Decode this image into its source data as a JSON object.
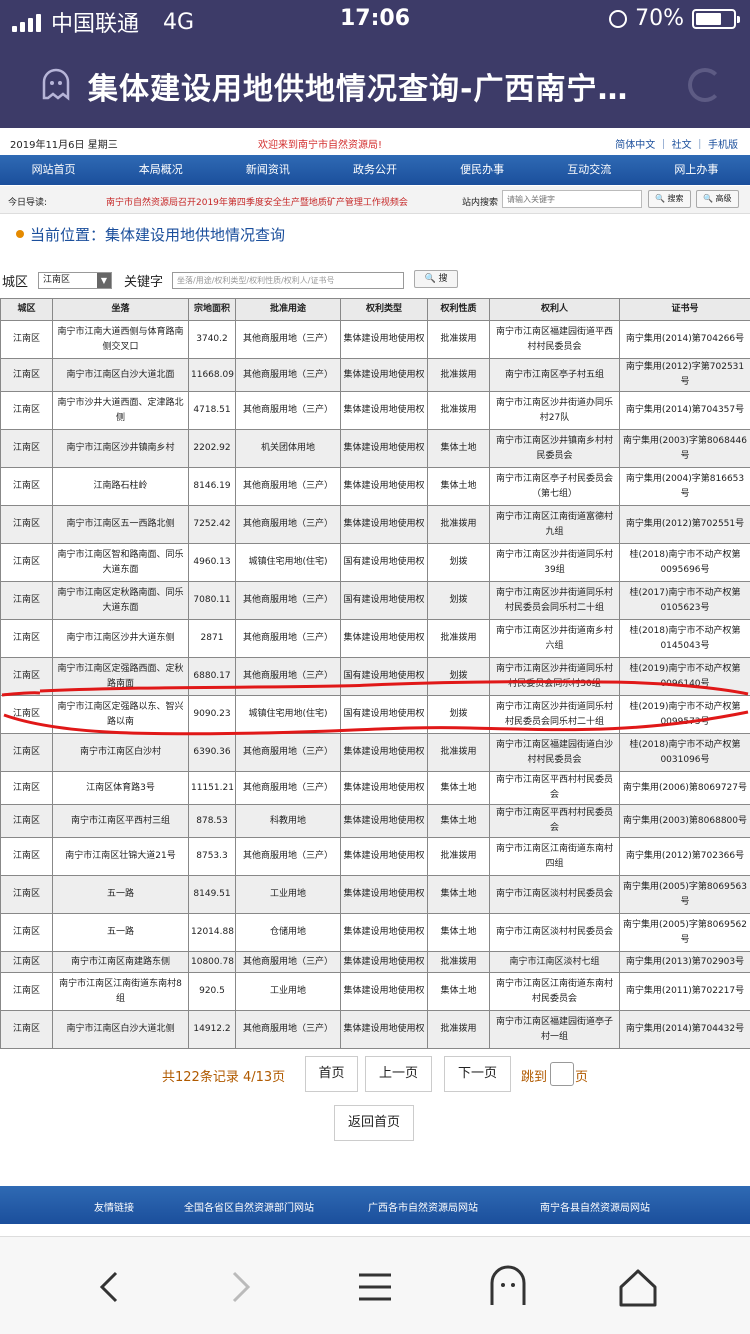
{
  "status": {
    "carrier": "中国联通",
    "network": "4G",
    "time": "17:06",
    "battery": "70%",
    "battery_level": 0.7
  },
  "title": "集体建设用地供地情况查询-广西南宁…",
  "site": {
    "date": "2019年11月6日 星期三",
    "welcome": "欢迎来到南宁市自然资源局!",
    "langs": "简体中文 ｜ 社文 ｜ 手机版",
    "nav": [
      "网站首页",
      "本局概况",
      "新闻资讯",
      "政务公开",
      "便民办事",
      "互动交流",
      "网上办事"
    ],
    "guide_label": "今日导读:",
    "guide_news": "南宁市自然资源局召开2019年第四季度安全生产暨地质矿产管理工作视频会",
    "search_label": "站内搜索",
    "search_placeholder": "请输入关键字",
    "search_btn": "搜索",
    "adv_btn": "高级"
  },
  "crumb": "当前位置：集体建设用地供地情况查询",
  "filter": {
    "district_label": "城区",
    "district_value": "江南区",
    "keyword_label": "关键字",
    "keyword_placeholder": "坐落/用途/权利类型/权利性质/权利人/证书号",
    "search_btn": "搜"
  },
  "table": {
    "headers": [
      "城区",
      "坐落",
      "宗地面积",
      "批准用途",
      "权利类型",
      "权利性质",
      "权利人",
      "证书号"
    ],
    "rows": [
      [
        "江南区",
        "南宁市江南大道西侧与体育路南侧交叉口",
        "3740.2",
        "其他商服用地（三产）",
        "集体建设用地使用权",
        "批准拨用",
        "南宁市江南区福建园街道平西村村民委员会",
        "南宁集用(2014)第704266号"
      ],
      [
        "江南区",
        "南宁市江南区白沙大道北面",
        "11668.09",
        "其他商服用地（三产）",
        "集体建设用地使用权",
        "批准拨用",
        "南宁市江南区亭子村五组",
        "南宁集用(2012)字第702531号"
      ],
      [
        "江南区",
        "南宁市沙井大道西面、定津路北侧",
        "4718.51",
        "其他商服用地（三产）",
        "集体建设用地使用权",
        "批准拨用",
        "南宁市江南区沙井街道办同乐村27队",
        "南宁集用(2014)第704357号"
      ],
      [
        "江南区",
        "南宁市江南区沙井镇南乡村",
        "2202.92",
        "机关团体用地",
        "集体建设用地使用权",
        "集体土地",
        "南宁市江南区沙井镇南乡村村民委员会",
        "南宁集用(2003)字第8068446号"
      ],
      [
        "江南区",
        "江南路石柱岭",
        "8146.19",
        "其他商服用地（三产）",
        "集体建设用地使用权",
        "集体土地",
        "南宁市江南区亭子村民委员会（第七组）",
        "南宁集用(2004)字第816653号"
      ],
      [
        "江南区",
        "南宁市江南区五一西路北侧",
        "7252.42",
        "其他商服用地（三产）",
        "集体建设用地使用权",
        "批准拨用",
        "南宁市江南区江南街道富德村九组",
        "南宁集用(2012)第702551号"
      ],
      [
        "江南区",
        "南宁市江南区智和路南面、同乐大道东面",
        "4960.13",
        "城镇住宅用地(住宅)",
        "国有建设用地使用权",
        "划拨",
        "南宁市江南区沙井街道同乐村39组",
        "桂(2018)南宁市不动产权第0095696号"
      ],
      [
        "江南区",
        "南宁市江南区定秋路南面、同乐大道东面",
        "7080.11",
        "其他商服用地（三产）",
        "国有建设用地使用权",
        "划拨",
        "南宁市江南区沙井街道同乐村村民委员会同乐村二十组",
        "桂(2017)南宁市不动产权第0105623号"
      ],
      [
        "江南区",
        "南宁市江南区沙井大道东侧",
        "2871",
        "其他商服用地（三产）",
        "集体建设用地使用权",
        "批准拨用",
        "南宁市江南区沙井街道南乡村六组",
        "桂(2018)南宁市不动产权第0145043号"
      ],
      [
        "江南区",
        "南宁市江南区定强路西面、定秋路南面",
        "6880.17",
        "其他商服用地（三产）",
        "国有建设用地使用权",
        "划拨",
        "南宁市江南区沙井街道同乐村村民委员会同乐村30组",
        "桂(2019)南宁市不动产权第0096140号"
      ],
      [
        "江南区",
        "南宁市江南区定强路以东、智兴路以南",
        "9090.23",
        "城镇住宅用地(住宅)",
        "国有建设用地使用权",
        "划拨",
        "南宁市江南区沙井街道同乐村村民委员会同乐村二十组",
        "桂(2019)南宁市不动产权第0099573号"
      ],
      [
        "江南区",
        "南宁市江南区白沙村",
        "6390.36",
        "其他商服用地（三产）",
        "集体建设用地使用权",
        "批准拨用",
        "南宁市江南区福建园街道白沙村村民委员会",
        "桂(2018)南宁市不动产权第0031096号"
      ],
      [
        "江南区",
        "江南区体育路3号",
        "11151.21",
        "其他商服用地（三产）",
        "集体建设用地使用权",
        "集体土地",
        "南宁市江南区平西村村民委员会",
        "南宁集用(2006)第8069727号"
      ],
      [
        "江南区",
        "南宁市江南区平西村三组",
        "878.53",
        "科教用地",
        "集体建设用地使用权",
        "集体土地",
        "南宁市江南区平西村村民委员会",
        "南宁集用(2003)第8068800号"
      ],
      [
        "江南区",
        "南宁市江南区壮锦大道21号",
        "8753.3",
        "其他商服用地（三产）",
        "集体建设用地使用权",
        "批准拨用",
        "南宁市江南区江南街道东南村四组",
        "南宁集用(2012)第702366号"
      ],
      [
        "江南区",
        "五一路",
        "8149.51",
        "工业用地",
        "集体建设用地使用权",
        "集体土地",
        "南宁市江南区淡村村民委员会",
        "南宁集用(2005)字第8069563号"
      ],
      [
        "江南区",
        "五一路",
        "12014.88",
        "仓储用地",
        "集体建设用地使用权",
        "集体土地",
        "南宁市江南区淡村村民委员会",
        "南宁集用(2005)字第8069562号"
      ],
      [
        "江南区",
        "南宁市江南区南建路东侧",
        "10800.78",
        "其他商服用地（三产）",
        "集体建设用地使用权",
        "批准拨用",
        "南宁市江南区淡村七组",
        "南宁集用(2013)第702903号"
      ],
      [
        "江南区",
        "南宁市江南区江南街道东南村8组",
        "920.5",
        "工业用地",
        "集体建设用地使用权",
        "集体土地",
        "南宁市江南区江南街道东南村村民委员会",
        "南宁集用(2011)第702217号"
      ],
      [
        "江南区",
        "南宁市江南区白沙大道北侧",
        "14912.2",
        "其他商服用地（三产）",
        "集体建设用地使用权",
        "批准拨用",
        "南宁市江南区福建园街道亭子村一组",
        "南宁集用(2014)第704432号"
      ]
    ]
  },
  "pager": {
    "info": "共122条记录  4/13页",
    "first": "首页",
    "prev": "上一页",
    "next": "下一页",
    "jump": "跳到",
    "page": "页",
    "back": "返回首页"
  },
  "footer": {
    "links": [
      "友情链接",
      "全国各省区自然资源部门网站",
      "广西各市自然资源局网站",
      "南宁各县自然资源局网站"
    ]
  },
  "colors": {
    "app_bar": "#3d3b68",
    "nav": "#1b4f9c",
    "accent_red": "#d32f2f",
    "pager_text": "#b05a00"
  }
}
